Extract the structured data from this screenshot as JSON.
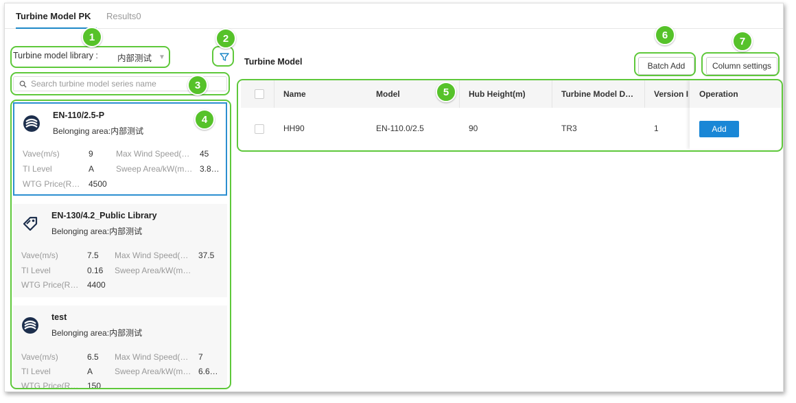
{
  "tabs": [
    {
      "label": "Turbine Model PK",
      "active": true
    },
    {
      "label": "Results0",
      "active": false
    }
  ],
  "library": {
    "label": "Turbine model library :",
    "value": "内部测试"
  },
  "search": {
    "placeholder": "Search turbine model series name"
  },
  "cards": [
    {
      "name": "EN-110/2.5-P",
      "area": "Belonging area:内部测试",
      "logo": "swirl-logo-icon",
      "rows": [
        {
          "k1": "Vave(m/s)",
          "v1": "9",
          "k2": "Max Wind Speed(…",
          "v2": "45"
        },
        {
          "k1": "TI Level",
          "v1": "A",
          "k2": "Sweep Area/kW(m…",
          "v2": "3.8…"
        },
        {
          "k1": "WTG Price(R…",
          "v1": "4500",
          "k2": "",
          "v2": ""
        }
      ]
    },
    {
      "name": "EN-130/4.2_Public Library",
      "area": "Belonging area:内部测试",
      "logo": "tag-icon",
      "rows": [
        {
          "k1": "Vave(m/s)",
          "v1": "7.5",
          "k2": "Max Wind Speed(…",
          "v2": "37.5"
        },
        {
          "k1": "TI Level",
          "v1": "0.16",
          "k2": "Sweep Area/kW(m…",
          "v2": ""
        },
        {
          "k1": "WTG Price(R…",
          "v1": "4400",
          "k2": "",
          "v2": ""
        }
      ]
    },
    {
      "name": "test",
      "area": "Belonging area:内部测试",
      "logo": "swirl-logo-icon",
      "rows": [
        {
          "k1": "Vave(m/s)",
          "v1": "6.5",
          "k2": "Max Wind Speed(…",
          "v2": "7"
        },
        {
          "k1": "TI Level",
          "v1": "A",
          "k2": "Sweep Area/kW(m…",
          "v2": "6.6…"
        },
        {
          "k1": "WTG Price(R…",
          "v1": "150",
          "k2": "",
          "v2": ""
        }
      ]
    }
  ],
  "main": {
    "title": "Turbine Model",
    "batch_add": "Batch Add",
    "column_settings": "Column settings"
  },
  "table": {
    "columns": [
      "Name",
      "Model",
      "Hub Height(m)",
      "Turbine Model D…",
      "Version I",
      "Operation"
    ],
    "rows": [
      {
        "name": "HH90",
        "model": "EN-110.0/2.5",
        "hub_height": "90",
        "turbine_model_d": "TR3",
        "version": "1",
        "action": "Add"
      }
    ]
  },
  "annotations": [
    "1",
    "2",
    "3",
    "4",
    "5",
    "6",
    "7"
  ],
  "colors": {
    "accent": "#1e88c7",
    "annotation": "#5ec83a",
    "add_button": "#1a87d6"
  }
}
